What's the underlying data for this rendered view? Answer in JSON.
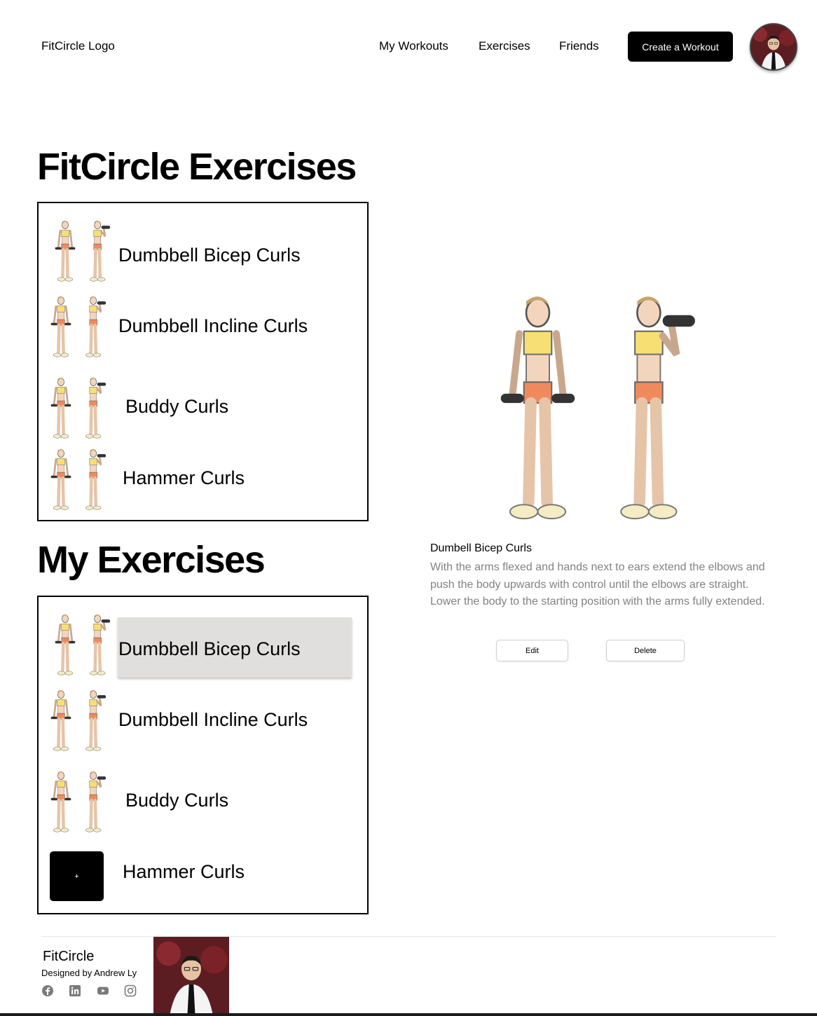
{
  "header": {
    "logo": "FitCircle Logo",
    "nav": [
      "My Workouts",
      "Exercises",
      "Friends"
    ],
    "cta": "Create a Workout",
    "avatar_icon": "user-avatar"
  },
  "fitcircle_exercises": {
    "title": "FitCircle Exercises",
    "items": [
      "Dumbbell Bicep Curls",
      "Dumbbell Incline Curls",
      "Buddy Curls",
      "Hammer Curls"
    ]
  },
  "my_exercises": {
    "title": "My Exercises",
    "items": [
      "Dumbbell Bicep Curls",
      "Dumbbell Incline Curls",
      "Buddy Curls",
      "Hammer Curls"
    ],
    "selected_index": 0,
    "add_label": "+"
  },
  "detail": {
    "title": "Dumbell Bicep Curls",
    "description": "With the arms flexed and hands next to ears extend the elbows and push the body upwards with control until the elbows are straight. Lower the body to the starting position with the arms fully extended.",
    "edit_label": "Edit",
    "delete_label": "Delete"
  },
  "footer": {
    "brand": "FitCircle",
    "credit": "Designed by Andrew Ly",
    "social_icons": [
      "facebook-icon",
      "linkedin-icon",
      "youtube-icon",
      "instagram-icon"
    ]
  },
  "colors": {
    "primary": "#000000",
    "muted_text": "#828282",
    "selected_row": "#e1dede",
    "shorts": "#f08a5d",
    "top": "#f7df73",
    "skin": "#f3d5bd"
  }
}
